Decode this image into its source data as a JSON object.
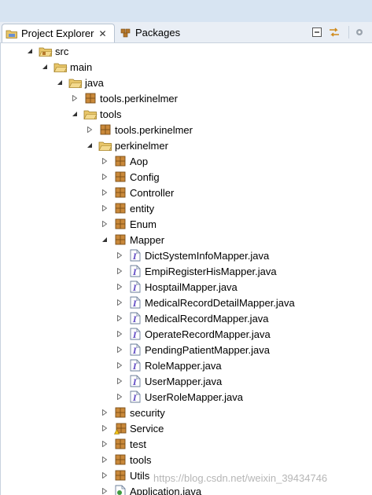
{
  "tabs": {
    "project_explorer": "Project Explorer",
    "packages": "Packages",
    "close_glyph": "✕"
  },
  "tree": [
    {
      "label": "src",
      "depth": 0,
      "icon": "source-folder-icon",
      "expanded": true
    },
    {
      "label": "main",
      "depth": 1,
      "icon": "folder-icon",
      "expanded": true
    },
    {
      "label": "java",
      "depth": 2,
      "icon": "folder-icon",
      "expanded": true
    },
    {
      "label": "tools.perkinelmer",
      "depth": 3,
      "icon": "package-icon",
      "expanded": false
    },
    {
      "label": "tools",
      "depth": 3,
      "icon": "folder-icon",
      "expanded": true
    },
    {
      "label": "tools.perkinelmer",
      "depth": 4,
      "icon": "package-icon",
      "expanded": false
    },
    {
      "label": "perkinelmer",
      "depth": 4,
      "icon": "folder-icon",
      "expanded": true
    },
    {
      "label": "Aop",
      "depth": 5,
      "icon": "package-icon",
      "expanded": false
    },
    {
      "label": "Config",
      "depth": 5,
      "icon": "package-icon",
      "expanded": false
    },
    {
      "label": "Controller",
      "depth": 5,
      "icon": "package-icon",
      "expanded": false
    },
    {
      "label": "entity",
      "depth": 5,
      "icon": "package-icon",
      "expanded": false
    },
    {
      "label": "Enum",
      "depth": 5,
      "icon": "package-icon",
      "expanded": false
    },
    {
      "label": "Mapper",
      "depth": 5,
      "icon": "package-icon",
      "expanded": true
    },
    {
      "label": "DictSystemInfoMapper.java",
      "depth": 6,
      "icon": "java-interface-icon",
      "expanded": false
    },
    {
      "label": "EmpiRegisterHisMapper.java",
      "depth": 6,
      "icon": "java-interface-icon",
      "expanded": false
    },
    {
      "label": "HosptailMapper.java",
      "depth": 6,
      "icon": "java-interface-icon",
      "expanded": false
    },
    {
      "label": "MedicalRecordDetailMapper.java",
      "depth": 6,
      "icon": "java-interface-icon",
      "expanded": false
    },
    {
      "label": "MedicalRecordMapper.java",
      "depth": 6,
      "icon": "java-interface-icon",
      "expanded": false
    },
    {
      "label": "OperateRecordMapper.java",
      "depth": 6,
      "icon": "java-interface-icon",
      "expanded": false
    },
    {
      "label": "PendingPatientMapper.java",
      "depth": 6,
      "icon": "java-interface-icon",
      "expanded": false
    },
    {
      "label": "RoleMapper.java",
      "depth": 6,
      "icon": "java-interface-icon",
      "expanded": false
    },
    {
      "label": "UserMapper.java",
      "depth": 6,
      "icon": "java-interface-icon",
      "expanded": false
    },
    {
      "label": "UserRoleMapper.java",
      "depth": 6,
      "icon": "java-interface-icon",
      "expanded": false
    },
    {
      "label": "security",
      "depth": 5,
      "icon": "package-icon",
      "expanded": false
    },
    {
      "label": "Service",
      "depth": 5,
      "icon": "package-warning-icon",
      "expanded": false
    },
    {
      "label": "test",
      "depth": 5,
      "icon": "package-icon",
      "expanded": false
    },
    {
      "label": "tools",
      "depth": 5,
      "icon": "package-icon",
      "expanded": false
    },
    {
      "label": "Utils",
      "depth": 5,
      "icon": "package-icon",
      "expanded": false
    },
    {
      "label": "Application.java",
      "depth": 5,
      "icon": "java-class-icon",
      "expanded": false
    }
  ],
  "watermark": "https://blog.csdn.net/weixin_39434746",
  "colors": {
    "folder": "#e8c66a",
    "package": "#b5772a",
    "interface": "#6a55c8",
    "tab_bg": "#e9eef5",
    "top_strip": "#d7e4f2"
  }
}
